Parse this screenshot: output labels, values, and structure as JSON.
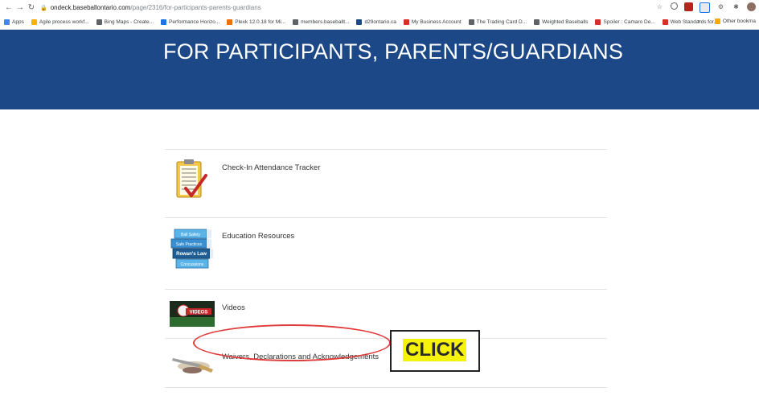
{
  "browser": {
    "url_host": "ondeck.baseballontario.com",
    "url_path": "/page/2316/for-participants-parents-guardians",
    "bookmarks": [
      {
        "label": "Apps",
        "color": "#4285f4"
      },
      {
        "label": "Agile process workf...",
        "color": "#f4b400"
      },
      {
        "label": "Bing Maps - Create...",
        "color": "#5f6368"
      },
      {
        "label": "Performance Horizo...",
        "color": "#1a73e8"
      },
      {
        "label": "Plexk 12.0.18 for Mi...",
        "color": "#e8710a"
      },
      {
        "label": "members.baseballt...",
        "color": "#5f6368"
      },
      {
        "label": "d29ontario.ca",
        "color": "#1c4887"
      },
      {
        "label": "My Business Account",
        "color": "#d93025"
      },
      {
        "label": "The Trading Card D...",
        "color": "#5f6368"
      },
      {
        "label": "Weighted Baseballs",
        "color": "#5f6368"
      },
      {
        "label": "Spoiler : Camaro De...",
        "color": "#d93025"
      },
      {
        "label": "Web Standards for...",
        "color": "#d93025"
      }
    ],
    "other_bookmarks": "Other bookma",
    "overflow": "»"
  },
  "hero": {
    "title": "FOR PARTICIPANTS, PARENTS/GUARDIANS",
    "bg": "#1c4887"
  },
  "items": [
    {
      "label": "Check-In Attendance Tracker"
    },
    {
      "label": "Education Resources"
    },
    {
      "label": "Videos"
    },
    {
      "label": "Waivers, Declarations and Acknowledgements"
    }
  ],
  "book_labels": [
    "Ball Safety",
    "Safe Practices",
    "Rowan's Law",
    "Concussions"
  ],
  "video_thumb_text": "VIDEOS",
  "annotation": {
    "text": "CLICK",
    "circle_color": "#e03b3b",
    "highlight": "#f6f30a"
  }
}
